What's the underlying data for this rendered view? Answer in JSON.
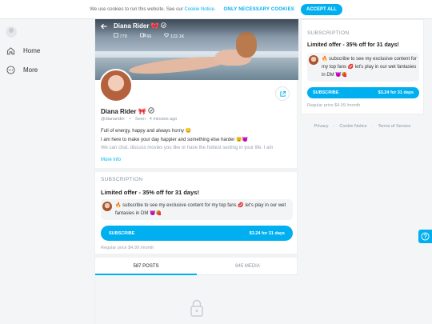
{
  "cookie": {
    "text": "We use cookies to run this website. See our",
    "link": "Cookie Notice",
    "period": ".",
    "necessary_label": "ONLY NECESSARY COOKIES",
    "accept_label": "ACCEPT ALL"
  },
  "nav": {
    "items": [
      {
        "label": "Home",
        "icon": "home-icon"
      },
      {
        "label": "More",
        "icon": "more-icon"
      }
    ]
  },
  "profile": {
    "name": "Diana Rider",
    "name_emoji": "🎀",
    "stats": {
      "photos": "779",
      "videos": "66",
      "likes": "122.1K"
    },
    "handle": "@dianarider",
    "separator": "•",
    "seen": "Seen · 4 minutes ago",
    "bio_lines": [
      "Full of energy, happy and always horny 😏",
      "I am here to make your day happier and something else harder 😉😈",
      "We can chat, discuss movies you like or have the hottest sexting in your life. I am"
    ],
    "more_info": "More info"
  },
  "subscription": {
    "label": "SUBSCRIPTION",
    "offer": "Limited offer - 35% off for 31 days!",
    "message": "🔥 subscribe to see my exclusive content for my top fans 💋 let's play in our wet fantasies in DM 😈🍓",
    "button_label": "SUBSCRIBE",
    "button_price": "$3.24 for 31 days",
    "regular": "Regular price $4.99 /month"
  },
  "right_subscription": {
    "label": "SUBSCRIPTION",
    "offer": "Limited offer - 35% off for 31 days!",
    "message": "🔥 subscribe to see my exclusive content for my top fans 💋 let's play in our wet fantasies in DM 😈🍓",
    "button_label": "SUBSCRIBE",
    "button_price": "$3.24 for 31 days",
    "regular": "Regular price $4.99 /month"
  },
  "tabs": [
    {
      "label": "587 POSTS",
      "active": true
    },
    {
      "label": "845 MEDIA",
      "active": false
    }
  ],
  "footer": {
    "privacy": "Privacy",
    "cookie_notice": "Cookie Notice",
    "terms": "Terms of Service",
    "dot": "·"
  },
  "colors": {
    "accent": "#00aff0",
    "muted": "#8a96a3"
  }
}
